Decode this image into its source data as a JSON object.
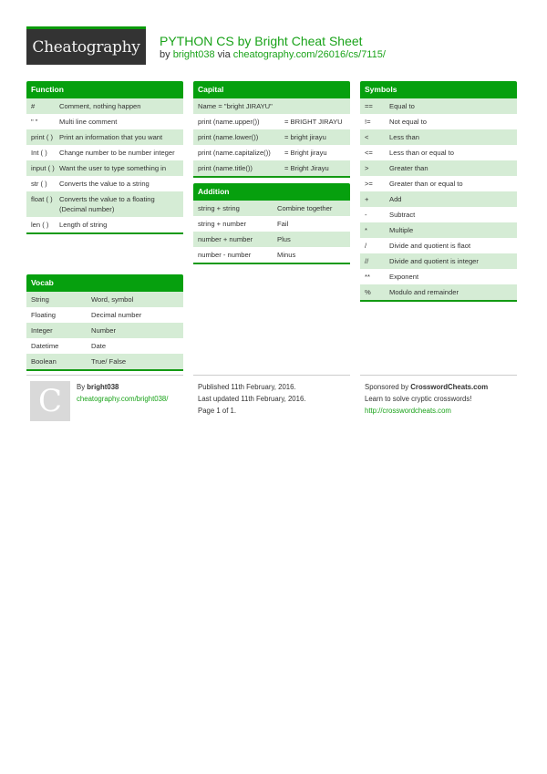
{
  "header": {
    "logo_text": "Cheatography",
    "title": "PYTHON CS by Bright Cheat Sheet",
    "by_prefix": "by",
    "author": "bright038",
    "via": "via",
    "url": "cheatography.com/26016/cs/7115/"
  },
  "colors": {
    "accent": "#06a00e",
    "row_alt": "#d5ecd5",
    "logo_bg": "#333333",
    "link": "#1aa31a"
  },
  "function": {
    "title": "Function",
    "rows": [
      {
        "k": "#",
        "v": "Comment, nothing happen"
      },
      {
        "k": "\" \"",
        "v": "Multi line comment"
      },
      {
        "k": "print ( )",
        "v": "Print an information that you want"
      },
      {
        "k": "Int ( )",
        "v": "Change number to be number integer"
      },
      {
        "k": "input ( )",
        "v": "Want the user to type something in"
      },
      {
        "k": "str ( )",
        "v": "Converts the value to a string"
      },
      {
        "k": "float ( )",
        "v": "Converts the value to a floating (Decimal number)"
      },
      {
        "k": "len ( )",
        "v": "Length of string"
      }
    ]
  },
  "vocab": {
    "title": "Vocab",
    "rows": [
      {
        "k": "String",
        "v": "Word, symbol"
      },
      {
        "k": "Floating",
        "v": "Decimal number"
      },
      {
        "k": "Integer",
        "v": "Number"
      },
      {
        "k": "Datetime",
        "v": "Date"
      },
      {
        "k": "Boolean",
        "v": "True/ False"
      }
    ]
  },
  "capital": {
    "title": "Capital",
    "rows": [
      {
        "k": "Name = \"bright JIRAYU\"",
        "v": ""
      },
      {
        "k": "print (name.upper())",
        "v": "= BRIGHT JIRAYU"
      },
      {
        "k": "print (name.lower())",
        "v": "= bright jirayu"
      },
      {
        "k": "print (name.capitalize())",
        "v": "= Bright jirayu"
      },
      {
        "k": "print (name.title())",
        "v": "= Bright Jirayu"
      }
    ]
  },
  "addition": {
    "title": "Addition",
    "rows": [
      {
        "k": "string + string",
        "v": "Combine together"
      },
      {
        "k": "string + number",
        "v": "Fail"
      },
      {
        "k": "number + number",
        "v": "Plus"
      },
      {
        "k": "number - number",
        "v": "Minus"
      }
    ]
  },
  "symbols": {
    "title": "Symbols",
    "rows": [
      {
        "k": "==",
        "v": "Equal to"
      },
      {
        "k": "!=",
        "v": "Not equal to"
      },
      {
        "k": "<",
        "v": "Less than"
      },
      {
        "k": "<=",
        "v": "Less than or equal to"
      },
      {
        "k": ">",
        "v": "Greater than"
      },
      {
        "k": ">=",
        "v": "Greater than or equal to"
      },
      {
        "k": "+",
        "v": "Add"
      },
      {
        "k": "-",
        "v": "Subtract"
      },
      {
        "k": "*",
        "v": "Multiple"
      },
      {
        "k": "/",
        "v": "Divide and quotient is flaot"
      },
      {
        "k": "//",
        "v": "Divide and quotient is integer"
      },
      {
        "k": "**",
        "v": "Exponent"
      },
      {
        "k": "%",
        "v": "Modulo and remainder"
      }
    ]
  },
  "footer": {
    "avatar_letter": "C",
    "by_label": "By",
    "author": "bright038",
    "author_url": "cheatography.com/bright038/",
    "published": "Published 11th February, 2016.",
    "updated": "Last updated 11th February, 2016.",
    "page": "Page 1 of 1.",
    "sponsored_prefix": "Sponsored by",
    "sponsor": "CrosswordCheats.com",
    "sponsor_tagline": "Learn to solve cryptic crosswords!",
    "sponsor_url": "http://crosswordcheats.com"
  }
}
